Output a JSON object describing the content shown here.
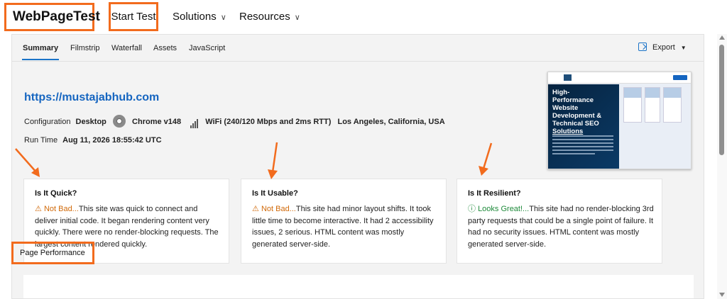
{
  "header": {
    "logo": "WebPageTest",
    "nav": [
      {
        "label": "Start Test"
      },
      {
        "label": "Solutions"
      },
      {
        "label": "Resources"
      }
    ]
  },
  "tabs": [
    "Summary",
    "Filmstrip",
    "Waterfall",
    "Assets",
    "JavaScript"
  ],
  "active_tab": "Summary",
  "export_label": "Export",
  "test": {
    "url": "https://mustajabhub.com",
    "config_label": "Configuration",
    "device": "Desktop",
    "browser": "Chrome v148",
    "connection": "WiFi (240/120 Mbps and 2ms RTT)",
    "location": "Los Angeles, California, USA",
    "runtime_label": "Run Time",
    "runtime": "Aug 11, 2026 18:55:42 UTC"
  },
  "screenshot_hero": {
    "line1": "High-",
    "line2": "Performance",
    "line3": "Website",
    "line4": "Development &",
    "line5": "Technical SEO",
    "line6": "Solutions"
  },
  "cards": [
    {
      "title": "Is It Quick?",
      "verdict_icon": "⚠",
      "verdict": "Not Bad...",
      "text": "This site was quick to connect and deliver initial code. It began rendering content very quickly. There were no render-blocking requests. The largest content rendered quickly."
    },
    {
      "title": "Is It Usable?",
      "verdict_icon": "⚠",
      "verdict": "Not Bad...",
      "text": "This site had minor layout shifts. It took little time to become interactive. It had 2 accessibility issues, 2 serious. HTML content was mostly generated server-side."
    },
    {
      "title": "Is It Resilient?",
      "verdict_icon": "ⓘ",
      "verdict": "Looks Great!...",
      "text": "This site had no render-blocking 3rd party requests that could be a single point of failure. It had no security issues. HTML content was mostly generated server-side."
    }
  ],
  "section": {
    "page_performance": "Page Performance"
  },
  "colors": {
    "highlight": "#f26b1d",
    "link": "#1565c0",
    "warning": "#d16a0a",
    "good": "#1e8a3a"
  }
}
